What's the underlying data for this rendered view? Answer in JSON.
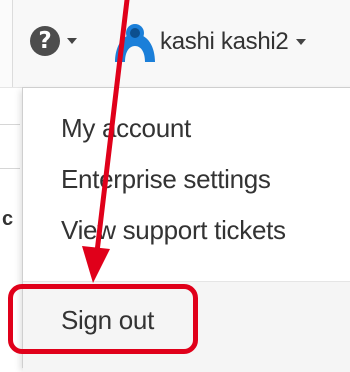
{
  "navbar": {
    "help_icon_glyph": "?",
    "username": "kashi kashi2"
  },
  "user_menu": {
    "items": [
      {
        "label": "My account"
      },
      {
        "label": "Enterprise settings"
      },
      {
        "label": "View support tickets"
      }
    ],
    "sign_out_label": "Sign out"
  },
  "background": {
    "partial_char": "c"
  },
  "annotation": {
    "color": "#e0001a",
    "target": "Sign out"
  },
  "colors": {
    "nav_background": "#f8f8f8",
    "avatar_blue": "#1b7fd9",
    "menu_text": "#333333"
  }
}
